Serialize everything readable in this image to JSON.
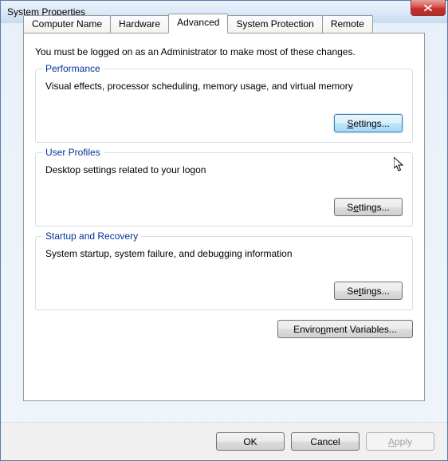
{
  "window": {
    "title": "System Properties"
  },
  "tabs": [
    {
      "label": "Computer Name"
    },
    {
      "label": "Hardware"
    },
    {
      "label": "Advanced"
    },
    {
      "label": "System Protection"
    },
    {
      "label": "Remote"
    }
  ],
  "active_tab": 2,
  "info_text": "You must be logged on as an Administrator to make most of these changes.",
  "groups": {
    "performance": {
      "legend": "Performance",
      "desc": "Visual effects, processor scheduling, memory usage, and virtual memory",
      "button": "Settings..."
    },
    "user_profiles": {
      "legend": "User Profiles",
      "desc": "Desktop settings related to your logon",
      "button": "Settings..."
    },
    "startup": {
      "legend": "Startup and Recovery",
      "desc": "System startup, system failure, and debugging information",
      "button": "Settings..."
    }
  },
  "env_button": "Environment Variables...",
  "bottom": {
    "ok": "OK",
    "cancel": "Cancel",
    "apply": "Apply"
  }
}
